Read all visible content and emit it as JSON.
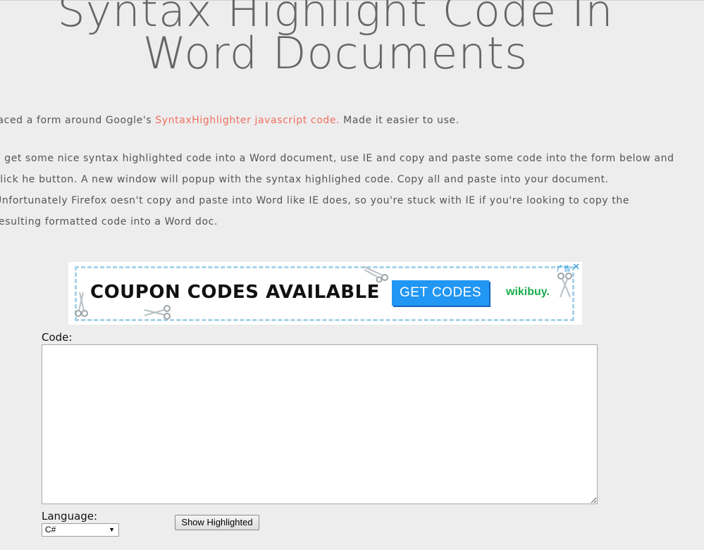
{
  "page": {
    "title": "Syntax Highlight Code In Word Documents"
  },
  "intro": {
    "before_link": "laced a form around Google's ",
    "link_text": "SyntaxHighlighter javascript code.",
    "after_link": " Made it easier to use."
  },
  "instructions": {
    "text": "o get some nice syntax highlighted code into a Word document, use IE and copy and paste some code into the form below and click he button. A new window will popup with the syntax highlighed code. Copy all and paste into your document. Unfortunately Firefox oesn't copy and paste into Word like IE does, so you're stuck with IE if you're looking to copy the resulting formatted code into a Word doc."
  },
  "ad": {
    "headline": "COUPON CODES AVAILABLE",
    "button_label": "GET CODES",
    "brand": "wikibuy.",
    "info_label": "广告",
    "close_label": "✕",
    "icons": [
      "scissors-icon",
      "close-icon"
    ]
  },
  "form": {
    "code_label": "Code:",
    "code_value": "",
    "language_label": "Language:",
    "language_selected": "C#",
    "submit_label": "Show Highlighted"
  },
  "colors": {
    "background": "#ededed",
    "title": "#666666",
    "body_text": "#555555",
    "link": "#f07060",
    "ad_button": "#2196f3",
    "ad_brand": "#1cae4c",
    "ad_border": "#a7d3ea"
  }
}
